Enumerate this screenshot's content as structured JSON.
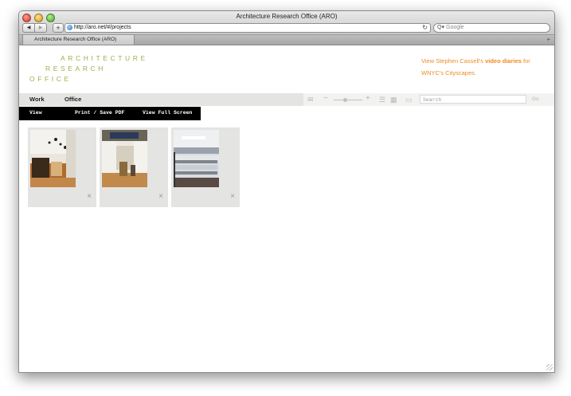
{
  "window": {
    "title": "Architecture Research Office (ARO)"
  },
  "toolbar": {
    "back_icon": "back-arrow-icon",
    "forward_icon": "forward-arrow-icon",
    "add_icon": "plus-icon",
    "url": "http://aro.net/#/projects",
    "reload_icon": "reload-icon",
    "search_placeholder": "Google"
  },
  "tabs": [
    {
      "label": "Architecture Research Office (ARO)"
    }
  ],
  "logo": {
    "line1": "ARCHITECTURE",
    "line2": "RESEARCH",
    "line3": "OFFICE",
    "color": "#9bb24a"
  },
  "promo": {
    "prefix": "View Stephen Cassell's ",
    "link": "video diaries",
    "middle": " for",
    "suffix": "WNYC's Cityscapes.",
    "color": "#f08a24"
  },
  "nav": {
    "work": "Work",
    "office": "Office",
    "search_placeholder": "Search",
    "go": "Go"
  },
  "subnav": {
    "view": "View",
    "print": "Print / Save PDF",
    "fullscreen": "View Full Screen"
  },
  "cards": [
    {
      "close": "×"
    },
    {
      "close": "×"
    },
    {
      "close": "×"
    }
  ]
}
